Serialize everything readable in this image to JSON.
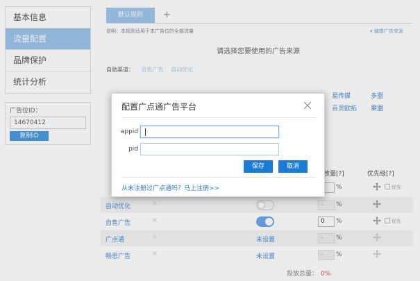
{
  "sidebar": {
    "items": [
      {
        "label": "基本信息",
        "active": false
      },
      {
        "label": "流量配置",
        "active": true
      },
      {
        "label": "品牌保护",
        "active": false
      },
      {
        "label": "统计分析",
        "active": false
      }
    ]
  },
  "ad_position": {
    "label": "广告位ID：",
    "value": "14670412",
    "copy_label": "复制ID"
  },
  "tabs": {
    "active_label": "默认规则",
    "add_label": "+"
  },
  "note": "说明：本规则适用于本广告位的全部流量",
  "edit_source_label": "编辑广告来源",
  "choose_title": "请选择您要使用的广告来源",
  "auto_channel": {
    "label": "自助渠道：",
    "items": [
      "自售广告",
      "自动优化"
    ]
  },
  "sources_visible": [
    "易传媒",
    "多盟",
    "百灵欧拓",
    "果盟"
  ],
  "table": {
    "headers": {
      "ratio": "投放量[?]",
      "priority": "优先级[?]"
    },
    "rows": [
      {
        "name": "…",
        "cross": "",
        "state": "hidden",
        "pct": "0",
        "priority_label": "优先"
      },
      {
        "name": "自动优化",
        "cross": "×",
        "state": "off",
        "pct": "-",
        "priority_label": ""
      },
      {
        "name": "自售广告",
        "cross": "×",
        "state": "on",
        "pct": "0",
        "priority_label": "优先"
      },
      {
        "name": "广点通",
        "cross": "×",
        "state": "unset",
        "unset_label": "未设置",
        "pct": "-",
        "priority_label": ""
      },
      {
        "name": "畅思广告",
        "cross": "×",
        "state": "unset",
        "unset_label": "未设置",
        "pct": "-",
        "priority_label": ""
      }
    ],
    "pct_sign": "%"
  },
  "total": {
    "label": "投放总量：",
    "value": "0%"
  },
  "modal": {
    "title": "配置广点通广告平台",
    "appid_label": "appid",
    "appid_value": "",
    "pid_label": "pid",
    "pid_value": "",
    "save_label": "保存",
    "cancel_label": "取消",
    "register_link": "从未注册过广点通吗？马上注册>>"
  },
  "colors": {
    "accent": "#9fc6ec",
    "primary_button": "#1a7ad6",
    "link": "#4a8cd4",
    "total_value": "#e05050"
  }
}
